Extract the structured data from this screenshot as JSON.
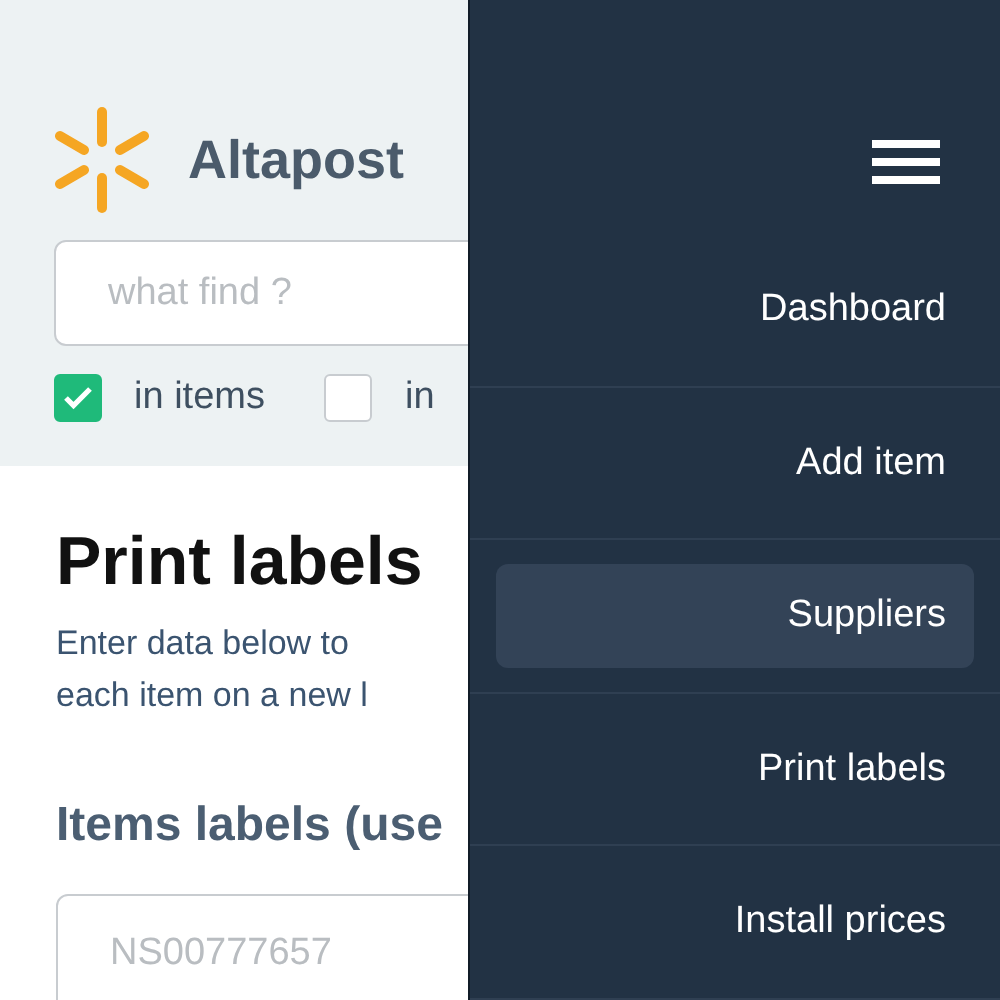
{
  "header": {
    "app_title": "Altapost"
  },
  "search": {
    "placeholder": "what find ?"
  },
  "filters": [
    {
      "label": "in items",
      "checked": true
    },
    {
      "label": "in",
      "checked": false
    }
  ],
  "page": {
    "title": "Print labels",
    "description_lines": [
      "Enter data below to",
      "each item on a new l"
    ],
    "field_label": "Items labels (use",
    "field_placeholder": "NS00777657"
  },
  "menu": {
    "items": [
      {
        "label": "Dashboard",
        "selected": false
      },
      {
        "label": "Add item",
        "selected": false
      },
      {
        "label": "Suppliers",
        "selected": true
      },
      {
        "label": "Print labels",
        "selected": false
      },
      {
        "label": "Install prices",
        "selected": false
      }
    ]
  }
}
